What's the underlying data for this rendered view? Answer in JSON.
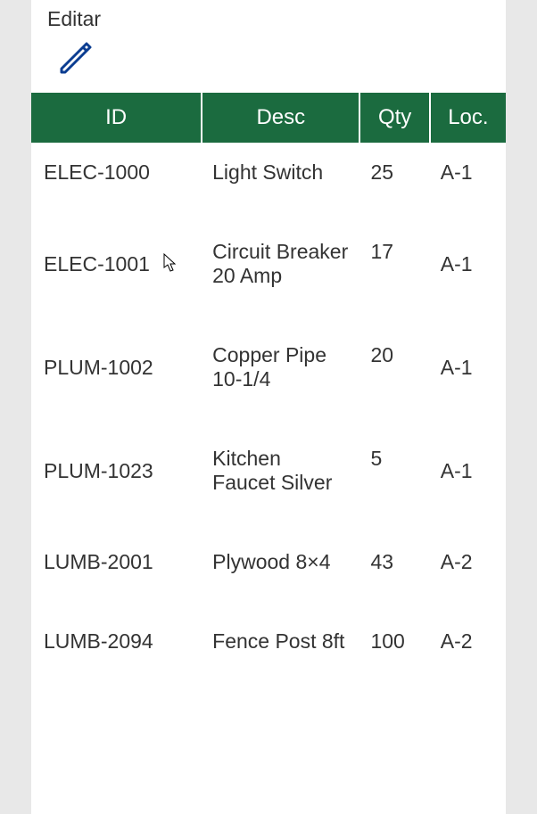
{
  "editar": {
    "label": "Editar"
  },
  "table": {
    "headers": {
      "id": "ID",
      "desc": "Desc",
      "qty": "Qty",
      "loc": "Loc."
    },
    "rows": [
      {
        "id": "ELEC-1000",
        "desc": "Light Switch",
        "qty": "25",
        "loc": "A-1"
      },
      {
        "id": "ELEC-1001",
        "desc": "Circuit Breaker 20 Amp",
        "qty": "17",
        "loc": "A-1"
      },
      {
        "id": "PLUM-1002",
        "desc": "Copper Pipe 10-1/4",
        "qty": "20",
        "loc": "A-1"
      },
      {
        "id": "PLUM-1023",
        "desc": "Kitchen Faucet Silver",
        "qty": "5",
        "loc": "A-1"
      },
      {
        "id": "LUMB-2001",
        "desc": "Plywood 8×4",
        "qty": "43",
        "loc": "A-2"
      },
      {
        "id": "LUMB-2094",
        "desc": "Fence Post 8ft",
        "qty": "100",
        "loc": "A-2"
      }
    ]
  }
}
